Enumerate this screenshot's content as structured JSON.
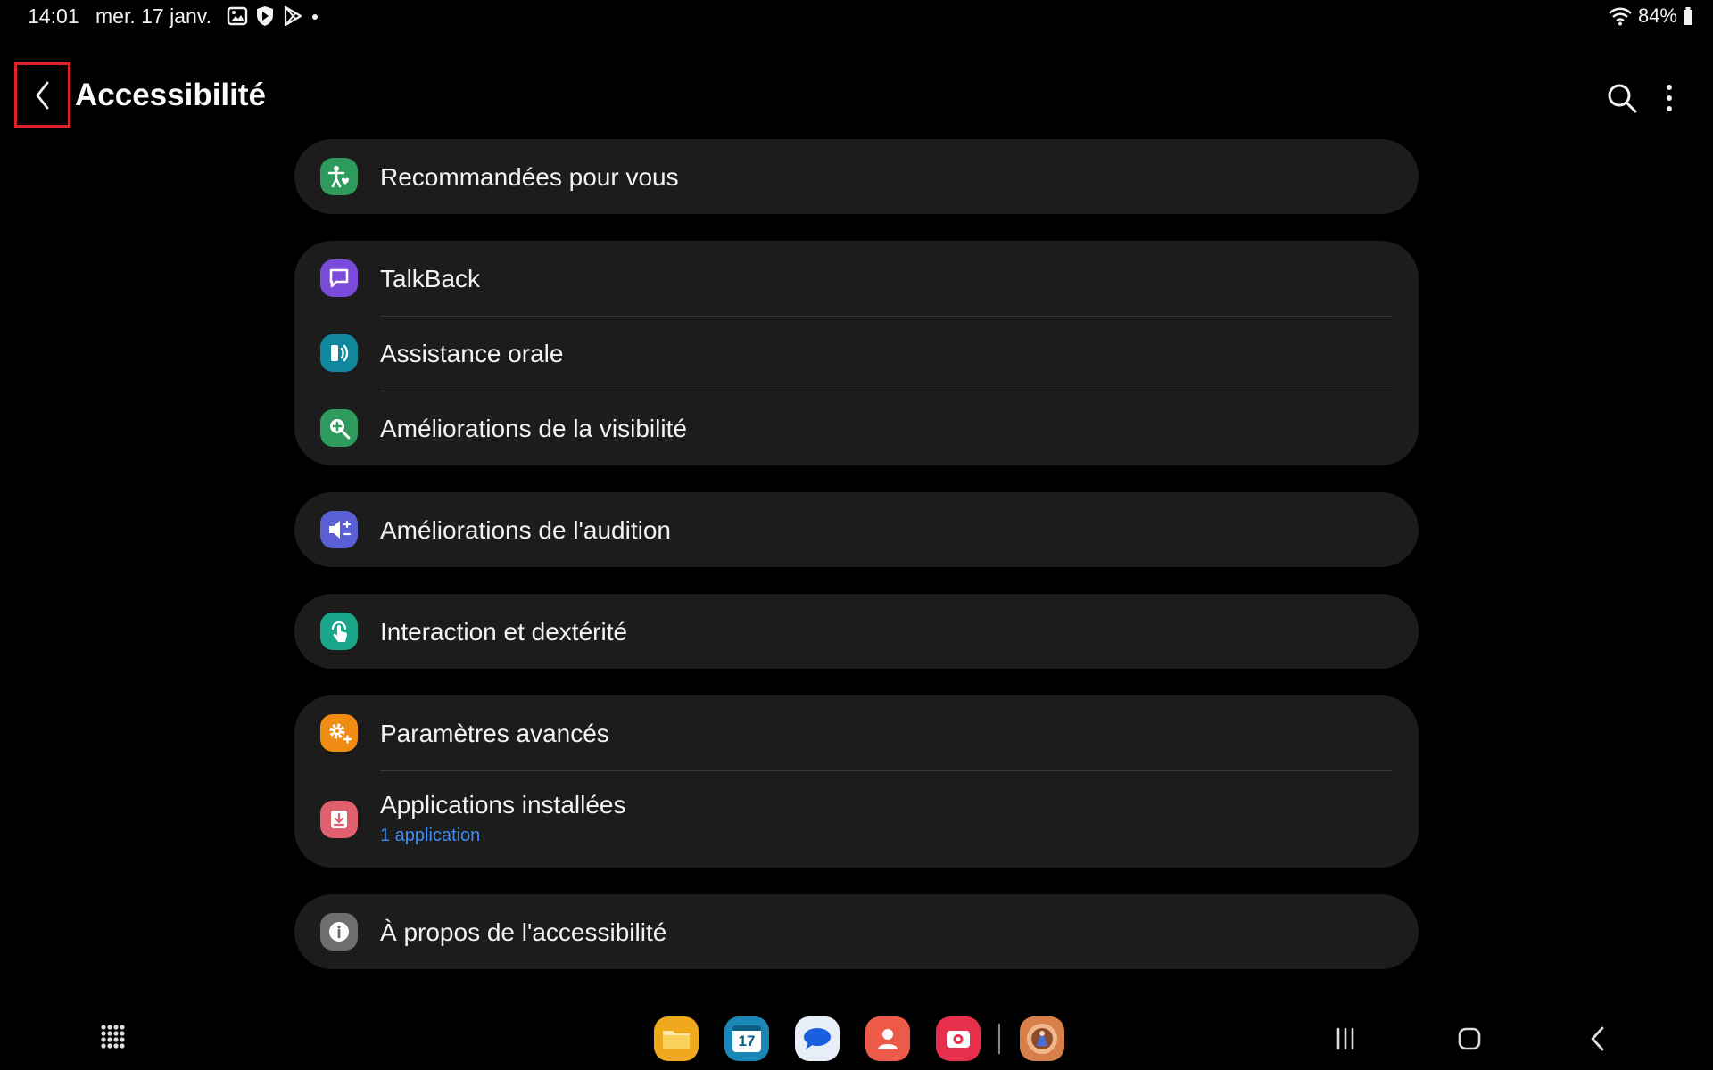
{
  "status_bar": {
    "time": "14:01",
    "date": "mer. 17 janv.",
    "notification_icons": [
      "gallery-icon",
      "shield-play-icon",
      "play-store-icon"
    ],
    "battery": "84%"
  },
  "header": {
    "title": "Accessibilité",
    "back_icon": "chevron-left-icon",
    "search_icon": "search-icon",
    "more_icon": "more-vertical-icon"
  },
  "groups": [
    {
      "items": [
        {
          "label": "Recommandées pour vous",
          "icon": "accessibility-person-icon",
          "color": "#2e9a5c"
        }
      ]
    },
    {
      "items": [
        {
          "label": "TalkBack",
          "icon": "talkback-icon",
          "color": "#7a4bd8"
        },
        {
          "label": "Assistance orale",
          "icon": "voice-assistant-icon",
          "color": "#11879e"
        },
        {
          "label": "Améliorations de la visibilité",
          "icon": "magnifier-icon",
          "color": "#2e9a5c"
        }
      ]
    },
    {
      "items": [
        {
          "label": "Améliorations de l'audition",
          "icon": "hearing-icon",
          "color": "#5b5fd6"
        }
      ]
    },
    {
      "items": [
        {
          "label": "Interaction et dextérité",
          "icon": "touch-icon",
          "color": "#1aa68a"
        }
      ]
    },
    {
      "items": [
        {
          "label": "Paramètres avancés",
          "icon": "advanced-gear-icon",
          "color": "#f08c14"
        },
        {
          "label": "Applications installées",
          "sublabel": "1 application",
          "icon": "installed-apps-icon",
          "color": "#e0606e"
        }
      ]
    },
    {
      "items": [
        {
          "label": "À propos de l'accessibilité",
          "icon": "info-icon",
          "color": "#6e6e6e"
        }
      ]
    }
  ],
  "nav_bar": {
    "app_drawer_icon": "app-grid-icon",
    "dock_apps": [
      {
        "name": "my-files-app",
        "color": "#f0a81c"
      },
      {
        "name": "calendar-app",
        "color": "#1b87b6",
        "text": "17"
      },
      {
        "name": "messages-app",
        "color": "#e8eef8"
      },
      {
        "name": "contacts-app",
        "color": "#ee5a4a"
      },
      {
        "name": "screen-recorder-app",
        "color": "#e8304c"
      },
      {
        "name": "game-app",
        "color": "#d9804a"
      }
    ],
    "recents_icon": "recents-icon",
    "home_icon": "home-icon",
    "back_icon": "back-icon"
  }
}
